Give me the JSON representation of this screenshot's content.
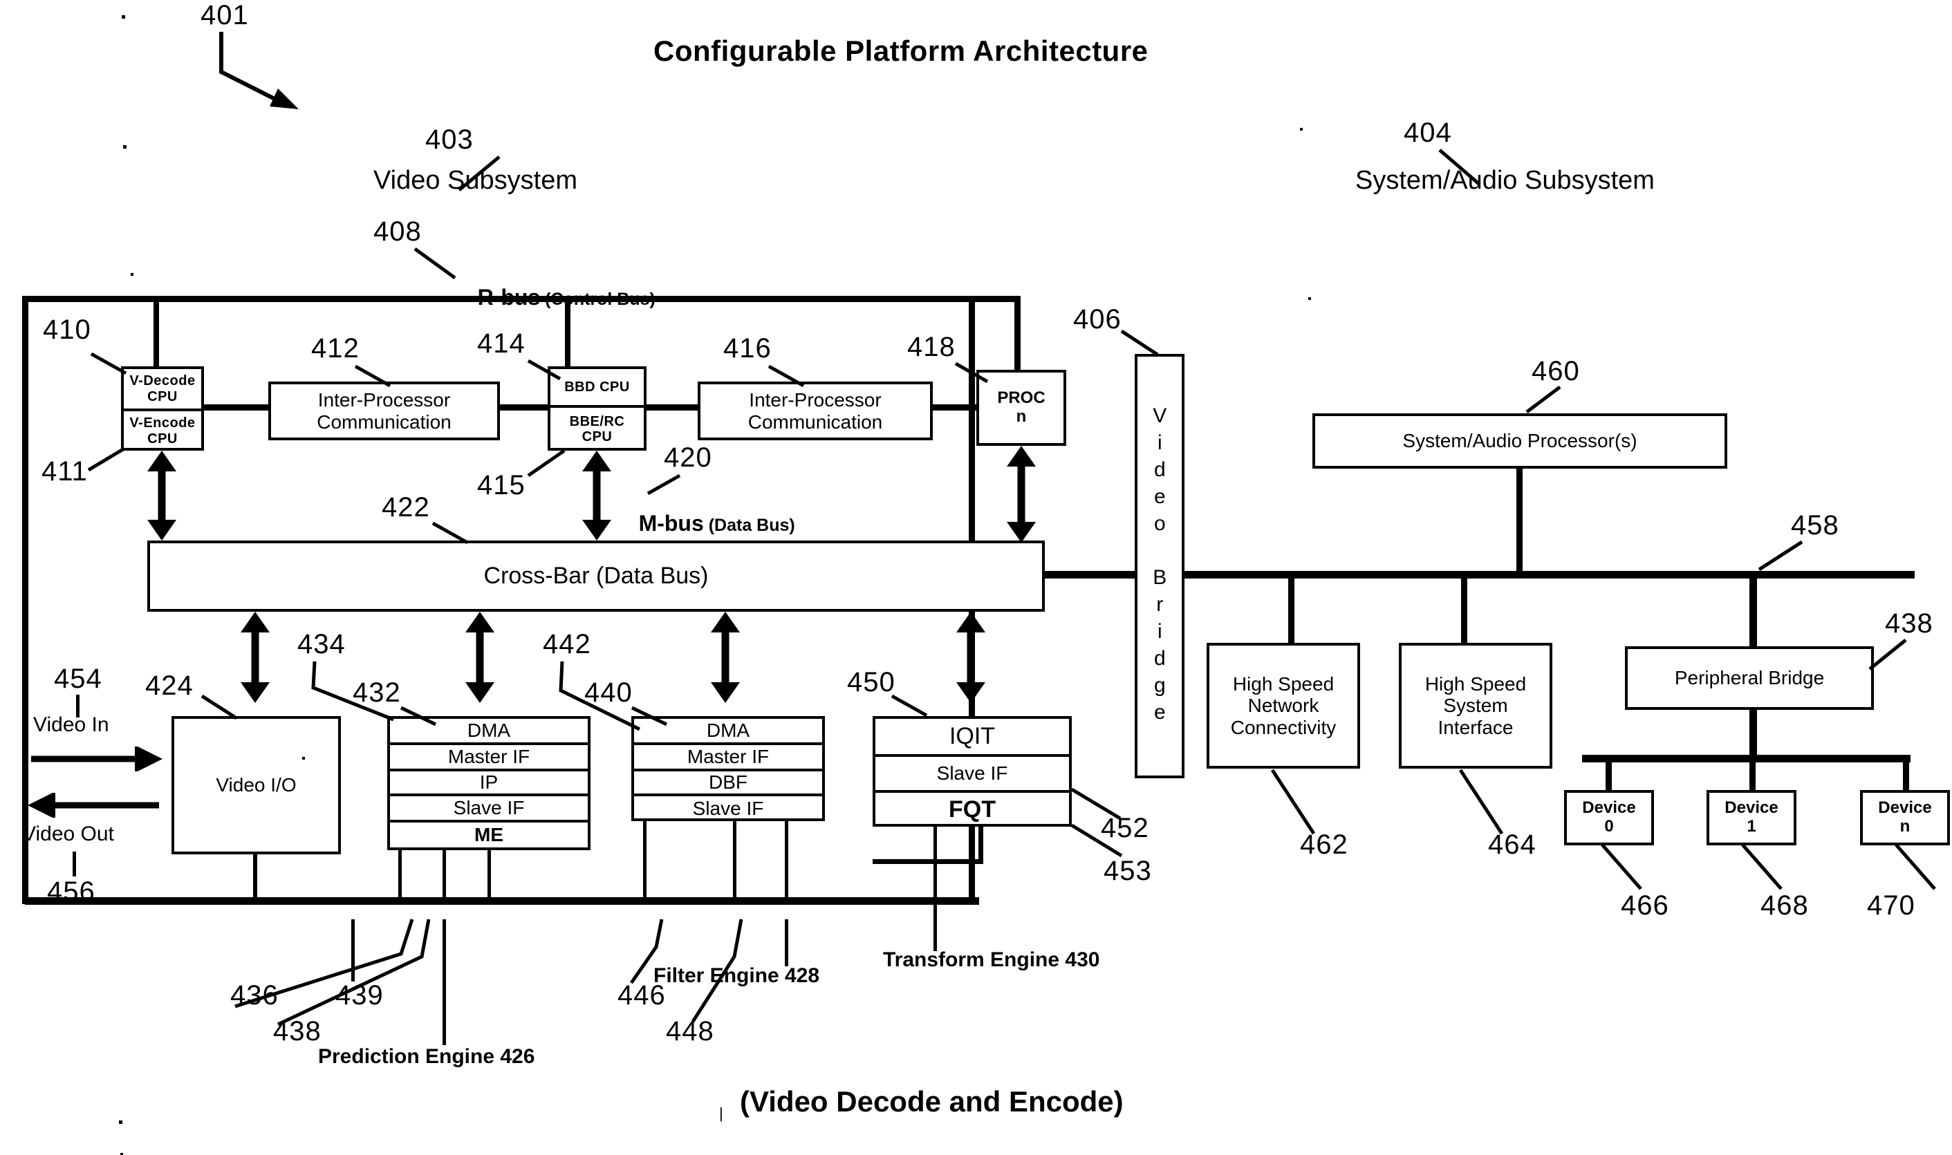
{
  "figure": {
    "title": "Configurable Platform Architecture",
    "caption": "(Video Decode and Encode)",
    "fig_ref": "401"
  },
  "subsystems": {
    "video": {
      "label": "Video Subsystem",
      "ref": "403"
    },
    "system_audio": {
      "label": "System/Audio Subsystem",
      "ref": "404"
    }
  },
  "buses": {
    "rbus": {
      "name": "R-bus",
      "qualifier": "(Control Bus)",
      "ref": "408"
    },
    "mbus": {
      "name": "M-bus",
      "qualifier": "(Data Bus)",
      "ref": "420"
    },
    "crossbar": {
      "label": "Cross-Bar (Data Bus)",
      "ref": "422"
    },
    "system_bus": {
      "ref": "458"
    }
  },
  "video_subsystem": {
    "cpu_stack_1": {
      "top": "V-Decode\nCPU",
      "bottom": "V-Encode\nCPU",
      "top_ref": "410",
      "bottom_ref": "411"
    },
    "ipc_left": {
      "label": "Inter-Processor\nCommunication",
      "ref": "412"
    },
    "cpu_stack_2": {
      "top": "BBD CPU",
      "bottom": "BBE/RC\nCPU",
      "top_ref": "414",
      "bottom_ref": "415"
    },
    "ipc_right": {
      "label": "Inter-Processor\nCommunication",
      "ref": "416"
    },
    "proc_n": {
      "label": "PROC\nn",
      "ref": "418"
    },
    "video_io": {
      "label": "Video I/O",
      "ref": "424",
      "in_label": "Video In",
      "in_ref": "454",
      "out_label": "Video Out",
      "out_ref": "456"
    },
    "prediction_engine": {
      "name": "Prediction Engine",
      "ref": "426",
      "rows": [
        "DMA",
        "Master IF",
        "IP",
        "Slave IF",
        "ME"
      ],
      "row_refs": [
        "432",
        "436",
        "438",
        "439",
        ""
      ],
      "port_ref": "434"
    },
    "filter_engine": {
      "name": "Filter Engine",
      "ref": "428",
      "rows": [
        "DMA",
        "Master IF",
        "DBF",
        "Slave IF"
      ],
      "row_refs": [
        "440",
        "446",
        "448",
        ""
      ],
      "port_ref": "442"
    },
    "transform_engine": {
      "name": "Transform Engine",
      "ref": "430",
      "rows": [
        "IQIT",
        "Slave IF",
        "FQT"
      ],
      "row_refs": [
        "",
        "452",
        "453"
      ],
      "port_ref": "450"
    }
  },
  "video_bridge": {
    "label": "Video Bridge",
    "ref": "406"
  },
  "system_audio_subsystem": {
    "processor": {
      "label": "System/Audio Processor(s)",
      "ref": "460"
    },
    "network": {
      "label": "High Speed\nNetwork\nConnectivity",
      "ref": "462"
    },
    "sysif": {
      "label": "High Speed\nSystem\nInterface",
      "ref": "464"
    },
    "peripheral_bridge": {
      "label": "Peripheral Bridge",
      "ref": "438"
    },
    "devices": [
      {
        "label": "Device\n0",
        "ref": "466"
      },
      {
        "label": "Device\n1",
        "ref": "468"
      },
      {
        "label": "Device\nn",
        "ref": "470"
      }
    ]
  },
  "colors": {
    "ink": "#000000",
    "paper": "#ffffff"
  }
}
